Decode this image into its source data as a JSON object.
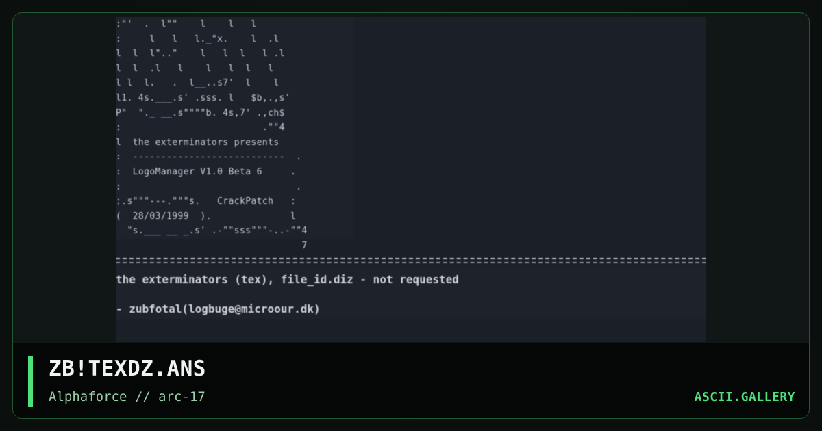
{
  "artwork": {
    "ascii_lines": [
      ":\"'  .  l\"\"    l    l   l",
      ":     l   l   l._\"x.    l  .l",
      "l  l  l\"..\"    l   l  l   l .l",
      "l  l  .l   l    l   l  l   l",
      "l l  l.   .  l__..s7'  l    l",
      "l1. 4s.___.s' .sss. l   $b,.,s'",
      "P\"  \"._ __.s\"\"\"\"b. 4s,7' .,ch$",
      ":                         .\"\"4",
      "l  the exterminators presents",
      ":  ---------------------------  .",
      ":  LogoManager V1.0 Beta 6     .",
      ":                               .",
      ":.s\"\"\"---.\"\"\"s.   CrackPatch   :",
      "(  28/03/1999  ).              l",
      "  \"s.___ __ _.s' .-\"\"sss\"\"\"-..-\"\"4",
      "                                 7"
    ],
    "info_line_1": "the exterminators (tex), file_id.diz - not requested",
    "info_line_2": "- zubfotal(logbuge@microour.dk)"
  },
  "footer": {
    "title": "ZB!TEXDZ.ANS",
    "subtitle": "Alphaforce // arc-17",
    "brand": "ASCII.GALLERY"
  },
  "colors": {
    "accent": "#4ee07a",
    "card_border": "#1f5a35",
    "preview_bg": "#1b1f27"
  }
}
